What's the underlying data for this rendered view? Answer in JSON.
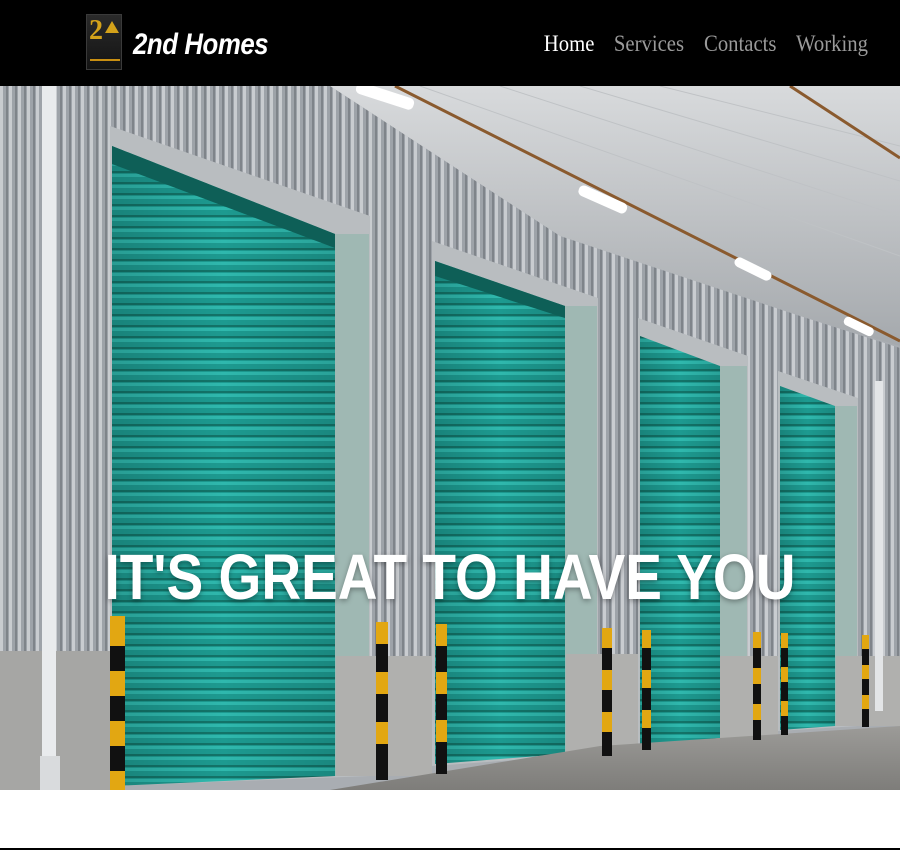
{
  "header": {
    "brand": "2nd Homes",
    "logo_mark": "2",
    "nav": [
      {
        "label": "Home",
        "active": true
      },
      {
        "label": "Services",
        "active": false
      },
      {
        "label": "Contacts",
        "active": false
      },
      {
        "label": "Working",
        "active": false
      }
    ]
  },
  "hero": {
    "title": "IT'S GREAT TO HAVE YOU",
    "image": "warehouse-roller-doors",
    "door_color": "#1f9e93"
  },
  "colors": {
    "header_bg": "#000000",
    "nav_active": "#ffffff",
    "nav_inactive": "#9a9a9a",
    "brand_gold": "#d4a21a"
  }
}
